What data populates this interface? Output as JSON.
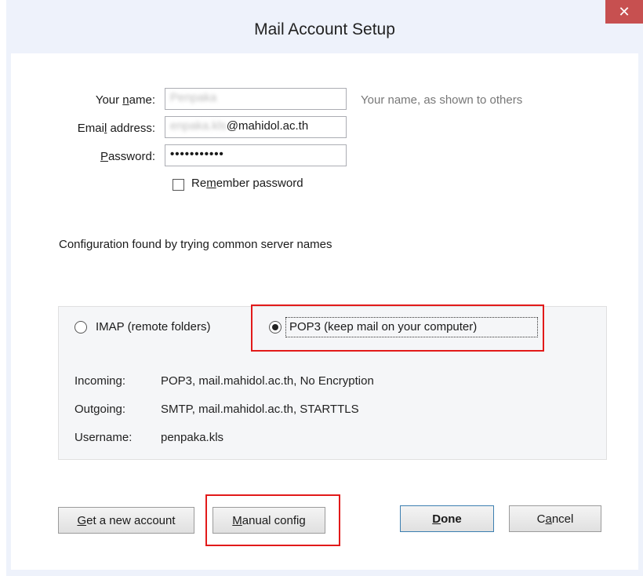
{
  "window": {
    "title": "Mail Account Setup",
    "close_symbol": "✕"
  },
  "form": {
    "name": {
      "label_before": "Your ",
      "label_access": "n",
      "label_after": "ame:",
      "value": "Penpaka",
      "hint": "Your name, as shown to others"
    },
    "email": {
      "label_before": "Emai",
      "label_access": "l",
      "label_after": " address:",
      "value_user": "enpaka.kls",
      "value_domain": "@mahidol.ac.th"
    },
    "password": {
      "label_access": "P",
      "label_after": "assword:",
      "value_masked": "•••••••••••"
    },
    "remember": {
      "label_before": "Re",
      "label_access": "m",
      "label_after": "ember password",
      "checked": false
    }
  },
  "status": {
    "message": "Configuration found by trying common server names"
  },
  "protocol": {
    "imap_label": "IMAP (remote folders)",
    "pop3_label": "POP3 (keep mail on your computer)",
    "selected": "pop3"
  },
  "server_info": {
    "incoming_label": "Incoming:",
    "incoming_value": "POP3, mail.mahidol.ac.th, No Encryption",
    "outgoing_label": "Outgoing:",
    "outgoing_value": "SMTP, mail.mahidol.ac.th, STARTTLS",
    "username_label": "Username:",
    "username_value": "penpaka.kls"
  },
  "buttons": {
    "new_account_access": "G",
    "new_account_rest": "et a new account",
    "manual_access": "M",
    "manual_rest": "anual config",
    "done_access": "D",
    "done_rest": "one",
    "cancel_before": "C",
    "cancel_access": "a",
    "cancel_rest": "ncel"
  },
  "annotation": {
    "highlight_color": "#e21a1a"
  }
}
